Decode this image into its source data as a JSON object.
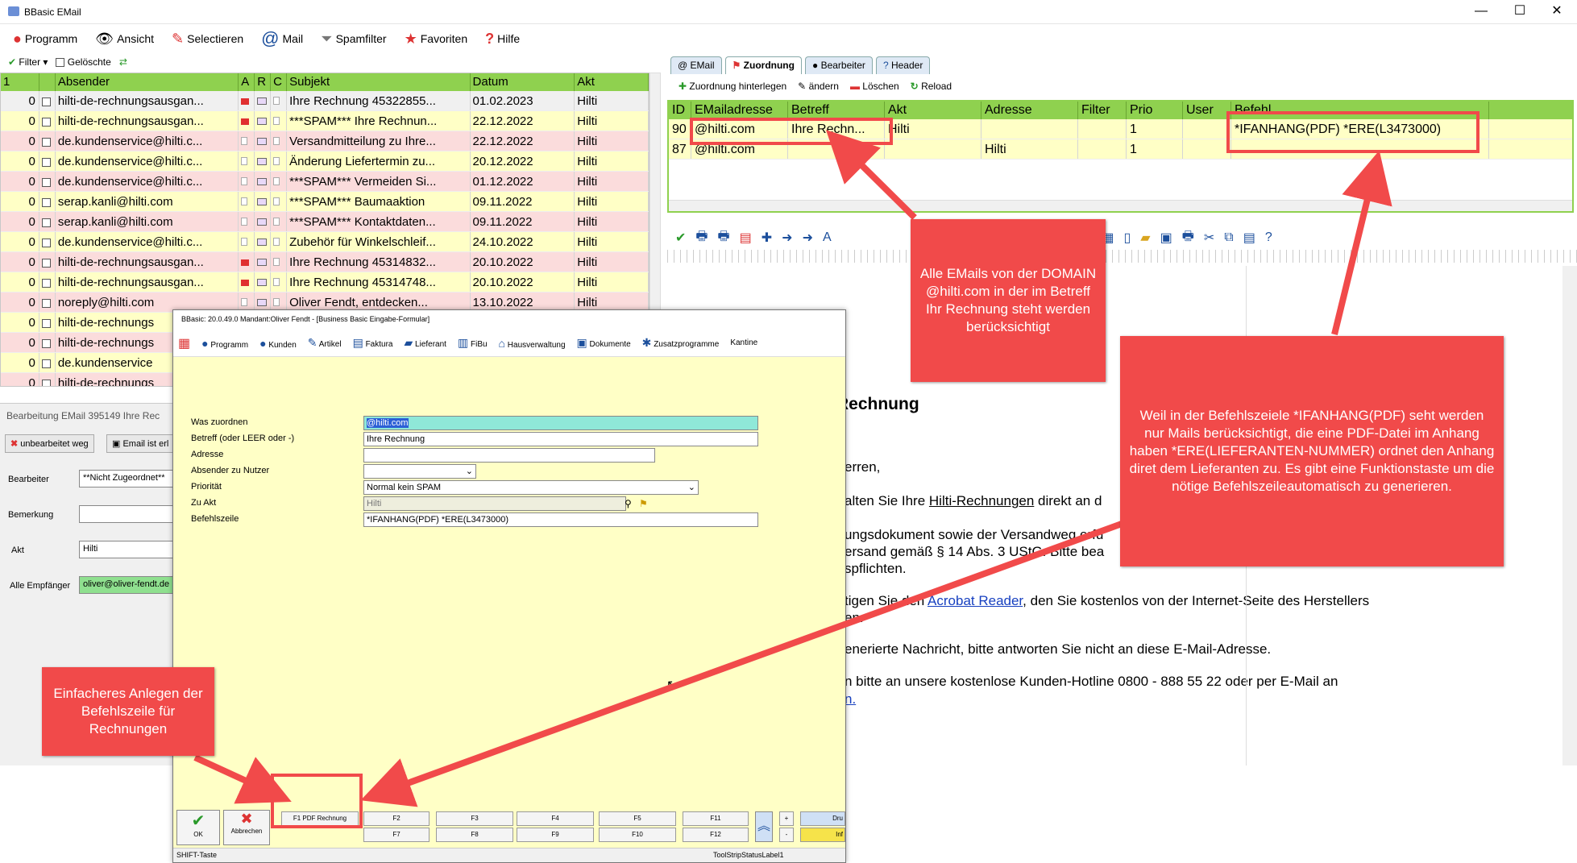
{
  "window": {
    "title": "BBasic EMail",
    "minimize": "—",
    "maximize": "☐",
    "close": "✕"
  },
  "menu": [
    {
      "label": "Programm",
      "icon": "program-icon"
    },
    {
      "label": "Ansicht",
      "icon": "eye-icon"
    },
    {
      "label": "Selectieren",
      "icon": "select-icon"
    },
    {
      "label": "Mail",
      "icon": "at-icon"
    },
    {
      "label": "Spamfilter",
      "icon": "funnel-icon"
    },
    {
      "label": "Favoriten",
      "icon": "star-icon"
    },
    {
      "label": "Hilfe",
      "icon": "question-icon"
    }
  ],
  "filterbar": {
    "filter": "Filter",
    "deleted": "Gelöschte"
  },
  "email_list": {
    "columns": [
      "1",
      "",
      "Absender",
      "A",
      "R",
      "C",
      "Subjekt",
      "Datum",
      "Akt"
    ],
    "rows": [
      {
        "n": "0",
        "sender": "hilti-de-rechnungsausgan...",
        "subject": "Ihre Rechnung 45322855...",
        "date": "01.02.2023",
        "akt": "Hilti",
        "bg": "sel",
        "flag": true
      },
      {
        "n": "0",
        "sender": "hilti-de-rechnungsausgan...",
        "subject": "***SPAM*** Ihre Rechnun...",
        "date": "22.12.2022",
        "akt": "Hilti",
        "bg": "y",
        "flag": true
      },
      {
        "n": "0",
        "sender": "de.kundenservice@hilti.c...",
        "subject": "Versandmitteilung zu Ihre...",
        "date": "22.12.2022",
        "akt": "Hilti",
        "bg": "p",
        "flag": false
      },
      {
        "n": "0",
        "sender": "de.kundenservice@hilti.c...",
        "subject": "Änderung Liefertermin zu...",
        "date": "20.12.2022",
        "akt": "Hilti",
        "bg": "y",
        "flag": false
      },
      {
        "n": "0",
        "sender": "de.kundenservice@hilti.c...",
        "subject": "***SPAM*** Vermeiden Si...",
        "date": "01.12.2022",
        "akt": "Hilti",
        "bg": "p",
        "flag": false
      },
      {
        "n": "0",
        "sender": "serap.kanli@hilti.com",
        "subject": "***SPAM*** Baumaaktion",
        "date": "09.11.2022",
        "akt": "Hilti",
        "bg": "y",
        "flag": false
      },
      {
        "n": "0",
        "sender": "serap.kanli@hilti.com",
        "subject": "***SPAM*** Kontaktdaten...",
        "date": "09.11.2022",
        "akt": "Hilti",
        "bg": "p",
        "flag": false
      },
      {
        "n": "0",
        "sender": "de.kundenservice@hilti.c...",
        "subject": "Zubehör für Winkelschleif...",
        "date": "24.10.2022",
        "akt": "Hilti",
        "bg": "y",
        "flag": false
      },
      {
        "n": "0",
        "sender": "hilti-de-rechnungsausgan...",
        "subject": "Ihre Rechnung 45314832...",
        "date": "20.10.2022",
        "akt": "Hilti",
        "bg": "p",
        "flag": true
      },
      {
        "n": "0",
        "sender": "hilti-de-rechnungsausgan...",
        "subject": "Ihre Rechnung 45314748...",
        "date": "20.10.2022",
        "akt": "Hilti",
        "bg": "y",
        "flag": true
      },
      {
        "n": "0",
        "sender": "noreply@hilti.com",
        "subject": "Oliver Fendt, entdecken...",
        "date": "13.10.2022",
        "akt": "Hilti",
        "bg": "p",
        "flag": false
      },
      {
        "n": "0",
        "sender": "hilti-de-rechnungs",
        "subject": "",
        "date": "",
        "akt": "",
        "bg": "y",
        "flag": false
      },
      {
        "n": "0",
        "sender": "hilti-de-rechnungs",
        "subject": "",
        "date": "",
        "akt": "",
        "bg": "p",
        "flag": false
      },
      {
        "n": "0",
        "sender": "de.kundenservice",
        "subject": "",
        "date": "",
        "akt": "",
        "bg": "y",
        "flag": false
      },
      {
        "n": "0",
        "sender": "hilti-de-rechnungs",
        "subject": "",
        "date": "",
        "akt": "",
        "bg": "p",
        "flag": false
      }
    ]
  },
  "left_panel": {
    "status": "Bearbeitung EMail 395149 Ihre Rec",
    "btn_unbearbeitet": "unbearbeitet weg",
    "btn_email": "Email ist erl",
    "bearbeiter_label": "Bearbeiter",
    "bearbeiter_value": "**Nicht Zugeordnet**",
    "bemerkung_label": "Bemerkung",
    "akt_label": "Akt",
    "akt_value": "Hilti",
    "empfaenger_label": "Alle Empfänger",
    "empfaenger_value": "oliver@oliver-fendt.de"
  },
  "tabs": [
    "EMail",
    "Zuordnung",
    "Bearbeiter",
    "Header"
  ],
  "zuordnung_toolbar": {
    "hinterlegen": "Zuordnung hinterlegen",
    "aendern": "ändern",
    "loeschen": "Löschen",
    "reload": "Reload"
  },
  "zuordnung_grid": {
    "columns": [
      "ID",
      "EMailadresse",
      "Betreff",
      "Akt",
      "Adresse",
      "Filter",
      "Prio",
      "User",
      "Befehl"
    ],
    "rows": [
      [
        "90",
        "@hilti.com",
        "Ihre Rechn...",
        "Hilti",
        "",
        "",
        "1",
        "",
        "*IFANHANG(PDF) *ERE(L3473000)"
      ],
      [
        "87",
        "@hilti.com",
        "",
        "",
        "Hilti",
        "",
        "1",
        "",
        ""
      ]
    ]
  },
  "mail_body": {
    "heading": "Rechnung",
    "l1": "erren,",
    "l2a": "alten Sie Ihre ",
    "l2link": "Hilti-Rechnungen",
    "l2b": " direkt an d",
    "l3": "ungsdokument sowie der Versandweg erfü",
    "l4": "ersand gemäß § 14 Abs. 3 UStG. Bitte bea",
    "l5": "spflichten.",
    "l6a": "tigen Sie den ",
    "l6link": "Acrobat Reader",
    "l6b": ", den Sie kostenlos von der Internet-Seite des Herstellers",
    "l7": "en.",
    "l8": "enerierte Nachricht, bitte antworten Sie nicht an diese E-Mail-Adresse.",
    "l9": "n bitte an unsere kostenlose Kunden-Hotline 0800 - 888 55 22 oder per E-Mail an",
    "l10": "n."
  },
  "popup": {
    "title": "BBasic: 20.0.49.0 Mandant:Oliver Fendt  - [Business Basic Eingabe-Formular]",
    "menu": [
      "Programm",
      "Kunden",
      "Artikel",
      "Faktura",
      "Lieferant",
      "FiBu",
      "Hausverwaltung",
      "Dokumente",
      "Zusatzprogramme",
      "Kantine"
    ],
    "labels": {
      "zuordnen": "Was zuordnen",
      "betreff": "Betreff (oder LEER oder -)",
      "adresse": "Adresse",
      "absender": "Absender zu Nutzer",
      "prioritaet": "Priorität",
      "zuakt": "Zu Akt",
      "befehl": "Befehlszeile"
    },
    "values": {
      "zuordnen": "@hilti.com",
      "betreff": "Ihre Rechnung",
      "adresse": "",
      "absender": "",
      "prioritaet": "Normal kein SPAM",
      "zuakt": "Hilti",
      "befehl": "*IFANHANG(PDF) *ERE(L3473000)"
    },
    "ok": "OK",
    "abbrechen": "Abbrechen",
    "fkeys_top": [
      "F1 PDF Rechnung",
      "F2",
      "F3",
      "F4",
      "F5",
      "F11"
    ],
    "fkeys_bottom": [
      "F7",
      "F8",
      "F9",
      "F10",
      "F12"
    ],
    "plus": "+",
    "minus": "-",
    "druck": "Dru",
    "info": "Inf",
    "status_left": "SHIFT-Taste",
    "status_right": "ToolStripStatusLabel1"
  },
  "annotations": {
    "domain_note": "Alle EMails von der DOMAIN @hilti.com in der im Betreff Ihr Rechnung steht werden berücksichtigt",
    "befehl_note": "Weil in der Befehlszeiele *IFANHANG(PDF) seht werden nur Mails berücksichtigt, die eine PDF-Datei im Anhang haben *ERE(LIEFERANTEN-NUMMER) ordnet den Anhang diret dem Lieferanten zu. Es gibt eine Funktionstaste um die nötige Befehlszeileautomatisch zu generieren.",
    "f1_note": "Einfacheres Anlegen der Befehlszeile für Rechnungen"
  },
  "colors": {
    "grid_header": "#8fd14f",
    "row_yellow": "#ffffc6",
    "row_pink": "#fbdcdc",
    "annotation_red": "#f14a4a"
  }
}
